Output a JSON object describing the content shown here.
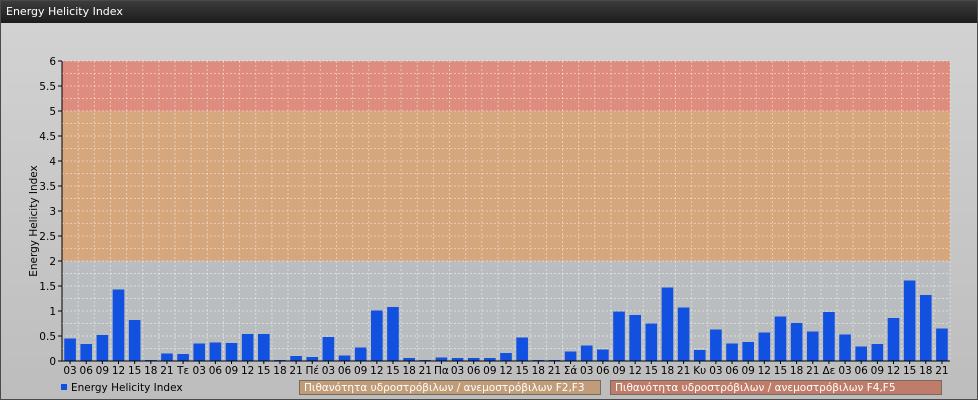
{
  "window": {
    "title": "Energy Helicity Index"
  },
  "legend": {
    "series_label": "Energy Helicity Index",
    "band1_label": "Πιθανότητα υδροστρόβιλων / ανεμοστρόβιλων F2,F3",
    "band2_label": "Πιθανότητα υδροστρόβιλων / ανεμοστρόβιλων F4,F5"
  },
  "colors": {
    "bar": "#1250e0",
    "band_low": "#b8bcc0",
    "band_mid": "#d8a070",
    "band_high": "#e08070"
  },
  "chart_data": {
    "type": "bar",
    "title": "",
    "xlabel": "",
    "ylabel": "Energy Helicity Index",
    "ylim": [
      0,
      6
    ],
    "yticks": [
      "0",
      "0.5",
      "1",
      "1.5",
      "2",
      "2.5",
      "3",
      "3.5",
      "4",
      "4.5",
      "5",
      "5.5",
      "6"
    ],
    "bands": [
      {
        "from": 0,
        "to": 2,
        "color": "#b8bcc0"
      },
      {
        "from": 2,
        "to": 5,
        "color": "#d8a070"
      },
      {
        "from": 5,
        "to": 6,
        "color": "#e08070"
      }
    ],
    "grid": true,
    "legend_position": "bottom-left",
    "categories": [
      "03",
      "06",
      "09",
      "12",
      "15",
      "18",
      "21",
      "Τε",
      "03",
      "06",
      "09",
      "12",
      "15",
      "18",
      "21",
      "Πέ",
      "03",
      "06",
      "09",
      "12",
      "15",
      "18",
      "21",
      "Πα",
      "03",
      "06",
      "09",
      "12",
      "15",
      "18",
      "21",
      "Σά",
      "03",
      "06",
      "09",
      "12",
      "15",
      "18",
      "21",
      "Κυ",
      "03",
      "06",
      "09",
      "12",
      "15",
      "18",
      "21",
      "Δε",
      "03",
      "06",
      "09",
      "12",
      "15",
      "18",
      "21"
    ],
    "series": [
      {
        "name": "Energy Helicity Index",
        "values": [
          0.45,
          0.34,
          0.52,
          1.43,
          0.82,
          0.02,
          0.15,
          0.14,
          0.35,
          0.37,
          0.36,
          0.54,
          0.54,
          0.02,
          0.1,
          0.08,
          0.48,
          0.11,
          0.27,
          1.01,
          1.08,
          0.06,
          0.02,
          0.07,
          0.06,
          0.06,
          0.06,
          0.16,
          0.47,
          0.02,
          0.02,
          0.19,
          0.31,
          0.23,
          0.99,
          0.92,
          0.75,
          1.47,
          1.07,
          0.22,
          0.63,
          0.35,
          0.38,
          0.57,
          0.89,
          0.76,
          0.59,
          0.98,
          0.53,
          0.29,
          0.34,
          0.86,
          1.61,
          1.32,
          0.65
        ]
      }
    ]
  }
}
